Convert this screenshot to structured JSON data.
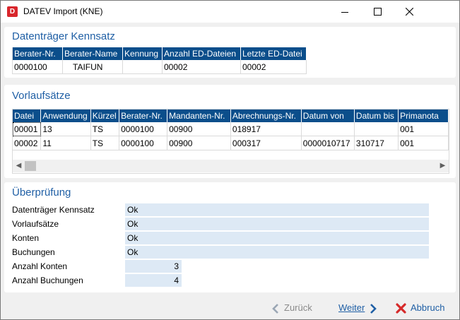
{
  "window": {
    "title": "DATEV Import (KNE)",
    "icon": "datev-app-icon",
    "icon_glyph": "D"
  },
  "datentraeger": {
    "section_title": "Datenträger Kennsatz",
    "columns": [
      "Berater-Nr.",
      "Berater-Name",
      "Kennung",
      "Anzahl ED-Dateien",
      "Letzte ED-Datei"
    ],
    "rows": [
      [
        "0000100",
        "TAIFUN",
        "",
        "00002",
        "00002"
      ]
    ]
  },
  "vorlauf": {
    "section_title": "Vorlaufsätze",
    "columns": [
      "Datei",
      "Anwendung",
      "Kürzel",
      "Berater-Nr.",
      "Mandanten-Nr.",
      "Abrechnungs-Nr.",
      "Datum von",
      "Datum bis",
      "Primanota"
    ],
    "rows": [
      [
        "00001",
        "13",
        "TS",
        "0000100",
        "00900",
        "018917",
        "",
        "",
        "001"
      ],
      [
        "00002",
        "11",
        "TS",
        "0000100",
        "00900",
        "000317",
        "0000010717",
        "310717",
        "001"
      ]
    ]
  },
  "pruefung": {
    "section_title": "Überprüfung",
    "items": [
      {
        "label": "Datenträger Kennsatz",
        "value": "Ok"
      },
      {
        "label": "Vorlaufsätze",
        "value": "Ok"
      },
      {
        "label": "Konten",
        "value": "Ok"
      },
      {
        "label": "Buchungen",
        "value": "Ok"
      },
      {
        "label": "Anzahl Konten",
        "value": "3"
      },
      {
        "label": "Anzahl Buchungen",
        "value": "4"
      }
    ]
  },
  "footer": {
    "back_label": "Zurück",
    "next_label": "Weiter",
    "cancel_label": "Abbruch"
  },
  "colors": {
    "accent": "#1f5fa5",
    "header_bg": "#0b4e8b",
    "cancel_red": "#d62a2a",
    "value_bg": "#dde9f5"
  }
}
